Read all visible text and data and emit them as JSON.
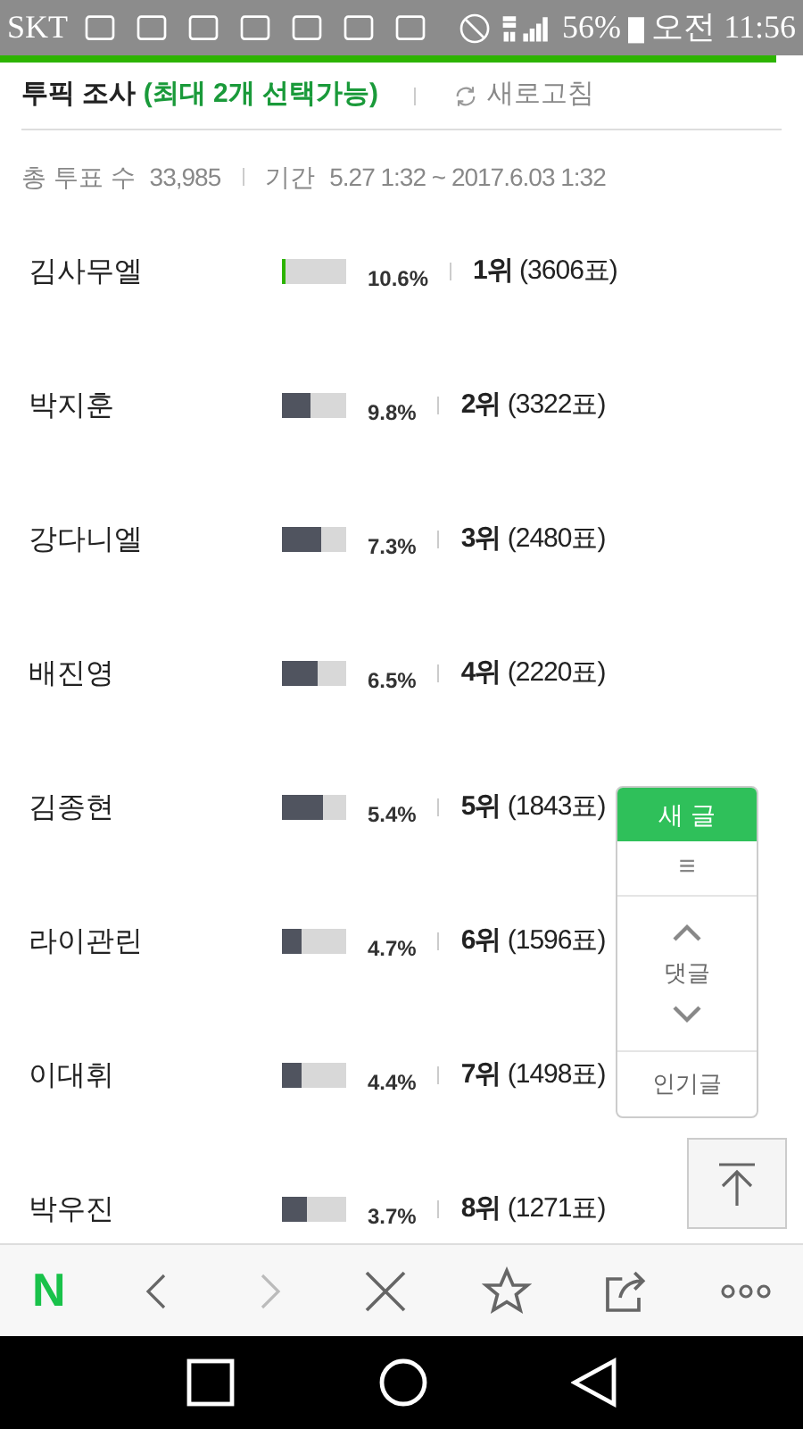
{
  "status_bar": {
    "carrier": "SKT",
    "battery": "56%",
    "time": "오전 11:56"
  },
  "header": {
    "title": "투픽 조사",
    "note": "(최대 2개 선택가능)",
    "refresh": "새로고침"
  },
  "stats": {
    "total_label": "총 투표 수",
    "total": "33,985",
    "period_label": "기간",
    "period": "5.27 1:32 ~ 2017.6.03 1:32"
  },
  "results": [
    {
      "name": "김사무엘",
      "level": 0.06,
      "color": "#2db400",
      "percent": "10.6%",
      "rank": "1위",
      "votes": "(3606표)"
    },
    {
      "name": "박지훈",
      "level": 0.45,
      "color": "#50545f",
      "percent": "9.8%",
      "rank": "2위",
      "votes": "(3322표)"
    },
    {
      "name": "강다니엘",
      "level": 0.6,
      "color": "#50545f",
      "percent": "7.3%",
      "rank": "3위",
      "votes": "(2480표)"
    },
    {
      "name": "배진영",
      "level": 0.55,
      "color": "#50545f",
      "percent": "6.5%",
      "rank": "4위",
      "votes": "(2220표)"
    },
    {
      "name": "김종현",
      "level": 0.65,
      "color": "#50545f",
      "percent": "5.4%",
      "rank": "5위",
      "votes": "(1843표)"
    },
    {
      "name": "라이관린",
      "level": 0.3,
      "color": "#50545f",
      "percent": "4.7%",
      "rank": "6위",
      "votes": "(1596표)"
    },
    {
      "name": "이대휘",
      "level": 0.3,
      "color": "#50545f",
      "percent": "4.4%",
      "rank": "7위",
      "votes": "(1498표)"
    },
    {
      "name": "박우진",
      "level": 0.4,
      "color": "#50545f",
      "percent": "3.7%",
      "rank": "8위",
      "votes": "(1271표)"
    }
  ],
  "float_panel": {
    "new_post": "새 글",
    "menu": "≡",
    "comments": "댓글",
    "popular": "인기글"
  },
  "toolbar": {
    "logo": "N"
  }
}
